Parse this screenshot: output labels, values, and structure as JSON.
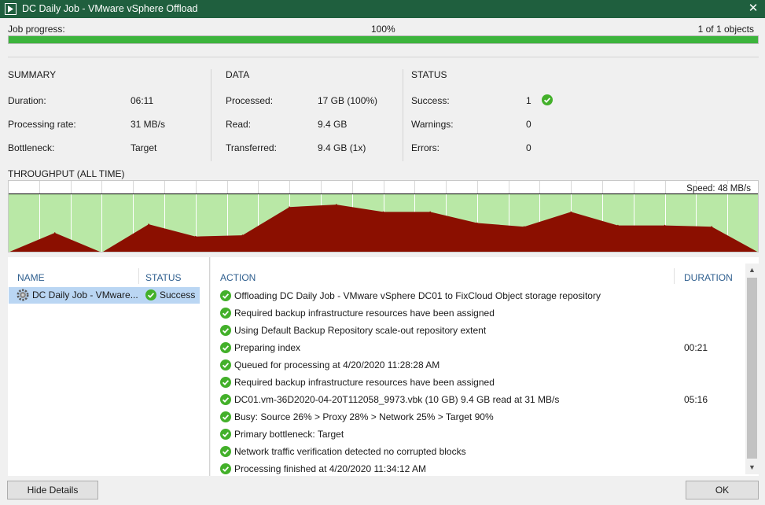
{
  "window": {
    "title": "DC Daily Job - VMware vSphere Offload",
    "close_symbol": "✕"
  },
  "progress": {
    "label": "Job progress:",
    "percent_text": "100%",
    "count_text": "1 of 1 objects",
    "fraction": 1.0
  },
  "summary": {
    "heading": "SUMMARY",
    "rows": [
      {
        "label": "Duration:",
        "value": "06:11"
      },
      {
        "label": "Processing rate:",
        "value": "31 MB/s"
      },
      {
        "label": "Bottleneck:",
        "value": "Target"
      }
    ]
  },
  "data_section": {
    "heading": "DATA",
    "rows": [
      {
        "label": "Processed:",
        "value": "17 GB (100%)"
      },
      {
        "label": "Read:",
        "value": "9.4 GB"
      },
      {
        "label": "Transferred:",
        "value": "9.4 GB (1x)"
      }
    ]
  },
  "status_section": {
    "heading": "STATUS",
    "rows": [
      {
        "label": "Success:",
        "value": "1"
      },
      {
        "label": "Warnings:",
        "value": "0"
      },
      {
        "label": "Errors:",
        "value": "0"
      }
    ]
  },
  "throughput": {
    "heading": "THROUGHPUT (ALL TIME)",
    "speed_label": "Speed: 48 MB/s"
  },
  "chart_data": {
    "type": "area",
    "title": "THROUGHPUT (ALL TIME)",
    "x": [
      0,
      1,
      2,
      3,
      4,
      5,
      6,
      7,
      8,
      9,
      10,
      11,
      12,
      13,
      14,
      15,
      16
    ],
    "values": [
      0,
      16,
      0,
      23,
      13,
      14,
      37,
      39,
      33,
      33,
      24,
      21,
      33,
      22,
      22,
      21,
      0
    ],
    "ylim": [
      0,
      48
    ],
    "annotations": [
      "Speed: 48 MB/s"
    ],
    "colors": {
      "fill": "#8b0f00",
      "background": "#b9e8a6",
      "grid": "#ffffff",
      "max_line": "#000000"
    }
  },
  "objects": {
    "columns": [
      "NAME",
      "STATUS"
    ],
    "rows": [
      {
        "name": "DC Daily Job - VMware...",
        "status": "Success"
      }
    ]
  },
  "actions": {
    "columns": [
      "ACTION",
      "DURATION"
    ],
    "rows": [
      {
        "text": "Offloading DC Daily Job - VMware vSphere DC01 to FixCloud Object storage repository",
        "duration": ""
      },
      {
        "text": "Required backup infrastructure resources have been assigned",
        "duration": ""
      },
      {
        "text": "Using Default Backup Repository scale-out repository extent",
        "duration": ""
      },
      {
        "text": "Preparing index",
        "duration": "00:21"
      },
      {
        "text": "Queued for processing at 4/20/2020 11:28:28 AM",
        "duration": ""
      },
      {
        "text": "Required backup infrastructure resources have been assigned",
        "duration": ""
      },
      {
        "text": "DC01.vm-36D2020-04-20T112058_9973.vbk (10 GB) 9.4 GB read at 31 MB/s",
        "duration": "05:16"
      },
      {
        "text": "Busy: Source 26% > Proxy 28% > Network 25% > Target 90%",
        "duration": ""
      },
      {
        "text": "Primary bottleneck: Target",
        "duration": ""
      },
      {
        "text": "Network traffic verification detected no corrupted blocks",
        "duration": ""
      },
      {
        "text": "Processing finished at 4/20/2020 11:34:12 AM",
        "duration": ""
      }
    ]
  },
  "buttons": {
    "hide_details": "Hide Details",
    "ok": "OK"
  },
  "icons": {
    "check": "check-circle-icon",
    "vm": "gear-vm-icon",
    "app": "veeam-play-icon"
  },
  "colors": {
    "titlebar": "#1f5f3e",
    "progress": "#3cb43c",
    "success": "#43b02a",
    "header_blue": "#2f5f8f",
    "selection": "#bad6f3"
  }
}
